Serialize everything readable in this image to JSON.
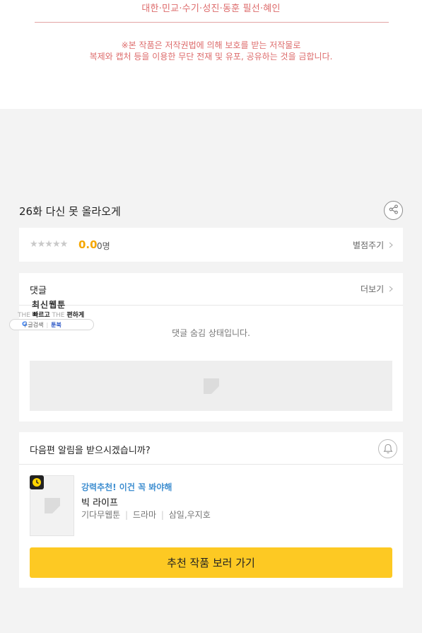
{
  "credits": {
    "line": "대한·민교·수기·성진·동훈   필선·혜인"
  },
  "copyright": {
    "line1": "※본 작품은 저작권법에 의해 보호를 받는 저작물로",
    "line2": "복제와 캡처 등을 이용한 무단 전재 및 유포, 공유하는 것을 금합니다."
  },
  "episode": {
    "title": "26화 다신 못 올라오게"
  },
  "rating": {
    "stars": "★★★★★",
    "score": "0.0",
    "count": "0명",
    "rate_link": "별점주기"
  },
  "comments": {
    "heading": "댓글",
    "more_link": "더보기",
    "hidden_message": "댓글 숨김 상태입니다."
  },
  "overlay_banner": {
    "title": "최신웹툰",
    "sub_the1": "THE",
    "sub_fast": "빠르고",
    "sub_the2": "THE",
    "sub_easy": "편하게",
    "google_mark": "G",
    "google_label": "구글검색",
    "toonbook_label": "툰북"
  },
  "alarm": {
    "question": "다음편 알림을 받으시겠습니까?"
  },
  "recommendation": {
    "tag": "강력추천! 이건 꼭 봐야해",
    "title": "빅 라이프",
    "meta_platform": "기다무웹툰",
    "meta_genre": "드라마",
    "meta_authors": "삼일,우지호",
    "cta_label": "추천 작품 보러 가기"
  },
  "colors": {
    "accent_yellow": "#fdc923",
    "score_orange": "#f5a700",
    "credit_red": "#dd6b6b",
    "tag_blue": "#3e8ed0"
  },
  "icons": [
    "share-icon",
    "bell-icon",
    "clock-icon",
    "image-placeholder-icon",
    "chevron-right-icon"
  ]
}
